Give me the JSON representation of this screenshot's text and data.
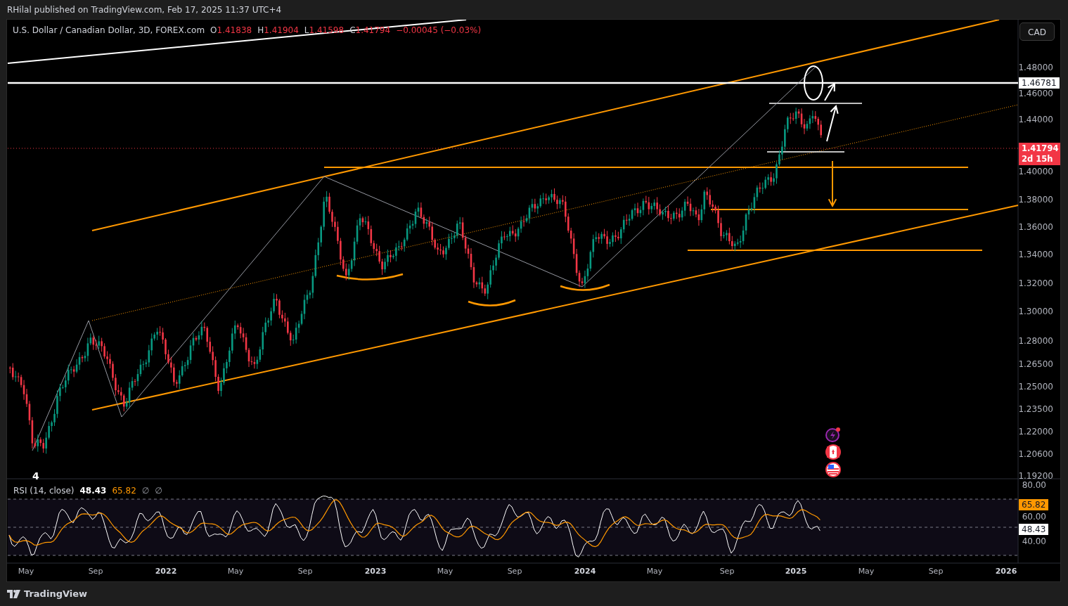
{
  "header": {
    "publisher_line": "RHilal published on TradingView.com, Feb 17, 2025 11:37 UTC+4"
  },
  "legend": {
    "symbol": "U.S. Dollar / Canadian Dollar, 3D, FOREX.com",
    "ohlc": [
      {
        "label": "O",
        "value": "1.41838"
      },
      {
        "label": "H",
        "value": "1.41904"
      },
      {
        "label": "L",
        "value": "1.41598"
      },
      {
        "label": "C",
        "value": "1.41794"
      }
    ],
    "change": "−0.00045 (−0.03%)"
  },
  "currency_button": "CAD",
  "price_axis": [
    "1.48000",
    "1.46000",
    "1.44000",
    "1.40000",
    "1.38000",
    "1.36000",
    "1.34000",
    "1.32000",
    "1.30000",
    "1.28000",
    "1.26500",
    "1.25000",
    "1.23500",
    "1.22000",
    "1.20600",
    "1.19200"
  ],
  "price_badges": [
    {
      "kind": "line",
      "text": "1.46781"
    },
    {
      "kind": "last",
      "text": "1.41794",
      "countdown": "2d 15h"
    }
  ],
  "wave_label": "4",
  "rsi": {
    "title": "RSI (14, close)",
    "value": "48.43",
    "ma": "65.82",
    "extras": [
      "∅",
      "∅"
    ],
    "axis": [
      "80.00",
      "60.00",
      "40.00"
    ],
    "badges": [
      {
        "kind": "ma",
        "text": "65.82"
      },
      {
        "kind": "value",
        "text": "48.43"
      }
    ]
  },
  "time_axis": [
    {
      "label": "May",
      "year": false
    },
    {
      "label": "Sep",
      "year": false
    },
    {
      "label": "2022",
      "year": true
    },
    {
      "label": "May",
      "year": false
    },
    {
      "label": "Sep",
      "year": false
    },
    {
      "label": "2023",
      "year": true
    },
    {
      "label": "May",
      "year": false
    },
    {
      "label": "Sep",
      "year": false
    },
    {
      "label": "2024",
      "year": true
    },
    {
      "label": "May",
      "year": false
    },
    {
      "label": "Sep",
      "year": false
    },
    {
      "label": "2025",
      "year": true
    },
    {
      "label": "May",
      "year": false
    },
    {
      "label": "Sep",
      "year": false
    },
    {
      "label": "2026",
      "year": true
    }
  ],
  "footer": {
    "brand": "TradingView"
  }
}
